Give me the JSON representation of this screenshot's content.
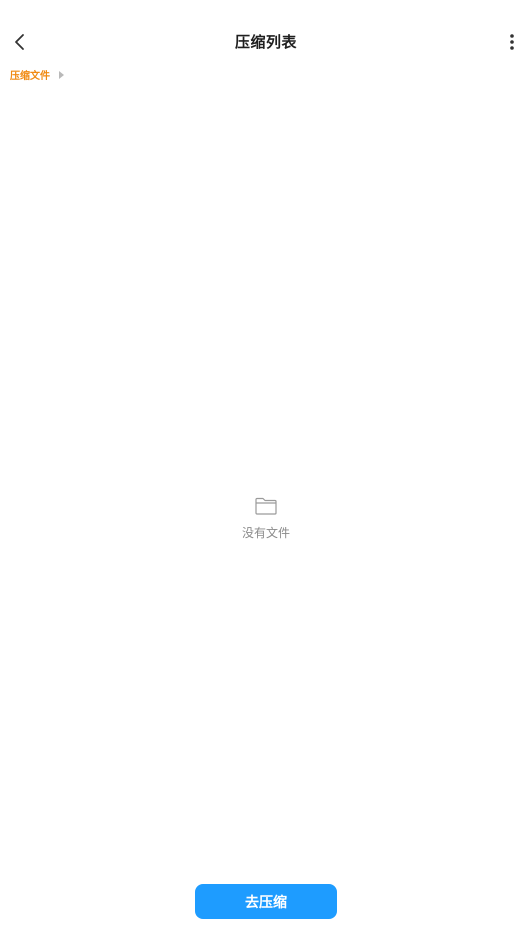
{
  "header": {
    "title": "压缩列表",
    "back_icon": "chevron-left-icon",
    "more_icon": "more-vertical-icon"
  },
  "breadcrumb": {
    "items": [
      {
        "label": "压缩文件"
      }
    ],
    "separator_icon": "triangle-right-icon"
  },
  "empty_state": {
    "icon": "folder-icon",
    "text": "没有文件"
  },
  "actions": {
    "compress_label": "去压缩"
  },
  "colors": {
    "breadcrumb_accent": "#f08a12",
    "primary_button": "#1e9cff",
    "empty_text": "#8a8a8a",
    "title_text": "#1f1f1f"
  }
}
